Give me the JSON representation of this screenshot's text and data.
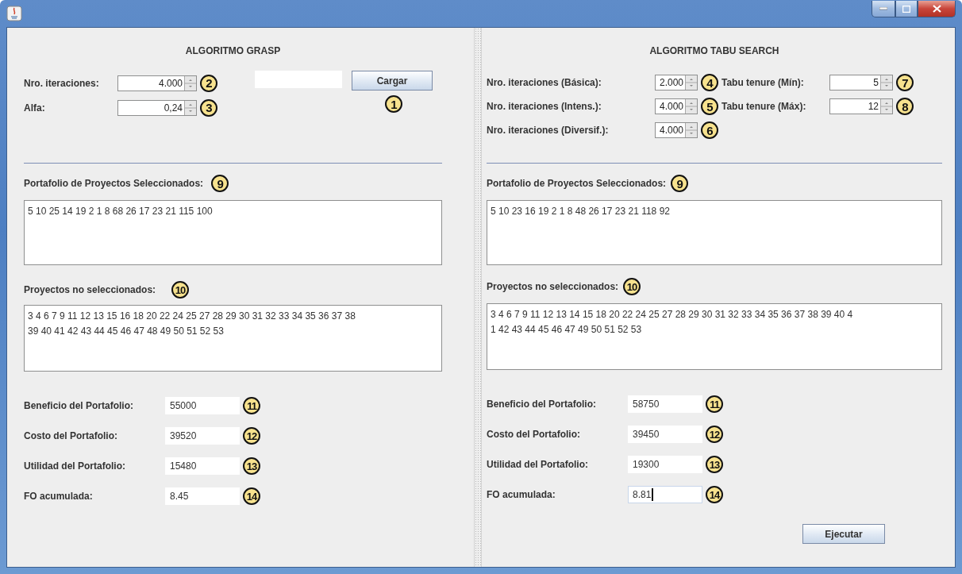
{
  "grasp": {
    "title": "ALGORITMO GRASP",
    "params": [
      {
        "label": "Nro. iteraciones:",
        "value": "4.000",
        "callout": "2"
      },
      {
        "label": "Alfa:",
        "value": "0,24",
        "callout": "3"
      }
    ],
    "load_button": {
      "label": "Cargar",
      "callout": "1"
    },
    "selected": {
      "label": "Portafolio de Proyectos Seleccionados:",
      "callout": "9",
      "lines": [
        "5 10 25 14 19 2 1 8 68 26 17 23 21 115 100"
      ]
    },
    "unselected": {
      "label": "Proyectos no seleccionados:",
      "callout": "10",
      "lines": [
        "3 4 6 7 9 11 12 13 15 16 18 20 22 24 25 27 28 29 30 31 32 33 34 35 36 37 38",
        "39 40 41 42 43 44 45 46 47 48 49 50 51 52 53"
      ]
    },
    "results": [
      {
        "label": "Beneficio del Portafolio:",
        "value": "55000",
        "callout": "11",
        "focused": false
      },
      {
        "label": "Costo del Portafolio:",
        "value": "39520",
        "callout": "12",
        "focused": false
      },
      {
        "label": "Utilidad del Portafolio:",
        "value": "15480",
        "callout": "13",
        "focused": false
      },
      {
        "label": "FO acumulada:",
        "value": "8.45",
        "callout": "14",
        "focused": false
      }
    ]
  },
  "tabu": {
    "title": "ALGORITMO TABU SEARCH",
    "params_left": [
      {
        "label": "Nro. iteraciones (Básica):",
        "value": "2.000",
        "callout": "4"
      },
      {
        "label": "Nro. iteraciones (Intens.):",
        "value": "4.000",
        "callout": "5"
      },
      {
        "label": "Nro. iteraciones (Diversif.):",
        "value": "4.000",
        "callout": "6"
      }
    ],
    "params_right": [
      {
        "label": "Tabu tenure (Mín):",
        "value": "5",
        "callout": "7"
      },
      {
        "label": "Tabu tenure (Máx):",
        "value": "12",
        "callout": "8"
      }
    ],
    "selected": {
      "label": "Portafolio de Proyectos Seleccionados:",
      "callout": "9",
      "lines": [
        "5 10 23 16 19 2 1 8 48 26 17 23 21 118 92"
      ]
    },
    "unselected": {
      "label": "Proyectos no seleccionados:",
      "callout": "10",
      "lines": [
        "3 4 6 7 9 11 12 13 14 15 18 20 22 24 25 27 28 29 30 31 32 33 34 35 36 37 38 39 40 4",
        "1 42 43 44 45 46 47 49 50 51 52 53"
      ]
    },
    "results": [
      {
        "label": "Beneficio del Portafolio:",
        "value": "58750",
        "callout": "11",
        "focused": false
      },
      {
        "label": "Costo del Portafolio:",
        "value": "39450",
        "callout": "12",
        "focused": false
      },
      {
        "label": "Utilidad del Portafolio:",
        "value": "19300",
        "callout": "13",
        "focused": false
      },
      {
        "label": "FO acumulada:",
        "value": "8.81",
        "callout": "14",
        "focused": true
      }
    ],
    "run_button": {
      "label": "Ejecutar"
    }
  }
}
